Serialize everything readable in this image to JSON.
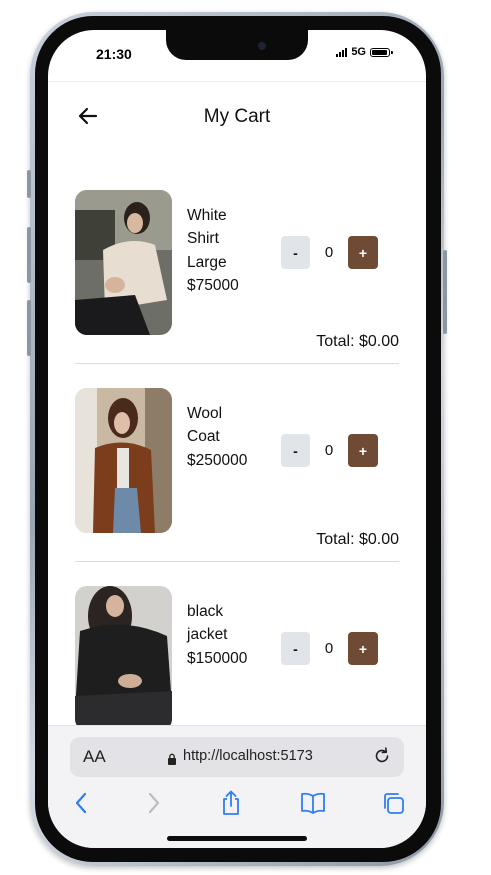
{
  "status_bar": {
    "time": "21:30",
    "network": "5G"
  },
  "header": {
    "title": "My Cart",
    "back_icon": "arrow-left-icon"
  },
  "items": [
    {
      "name_lines": [
        "White",
        "Shirt",
        "Large"
      ],
      "price": "$75000",
      "qty": "0",
      "minus_label": "-",
      "plus_label": "+",
      "total": "Total: $0.00",
      "image": "woman-white-shirt-photo"
    },
    {
      "name_lines": [
        "Wool",
        "Coat"
      ],
      "price": "$250000",
      "qty": "0",
      "minus_label": "-",
      "plus_label": "+",
      "total": "Total: $0.00",
      "image": "woman-brown-coat-photo"
    },
    {
      "name_lines": [
        "black",
        "jacket"
      ],
      "price": "$150000",
      "qty": "0",
      "minus_label": "-",
      "plus_label": "+",
      "total": "",
      "image": "woman-black-jacket-photo"
    }
  ],
  "browser": {
    "text_size_label": "AA",
    "url": "http://localhost:5173",
    "toolbar_icons": [
      "back-icon",
      "forward-icon",
      "share-icon",
      "bookmarks-icon",
      "tabs-icon"
    ]
  },
  "colors": {
    "accent_brown": "#6f4a34",
    "minus_bg": "#e1e4e8",
    "safari_blue": "#2f7df6"
  }
}
